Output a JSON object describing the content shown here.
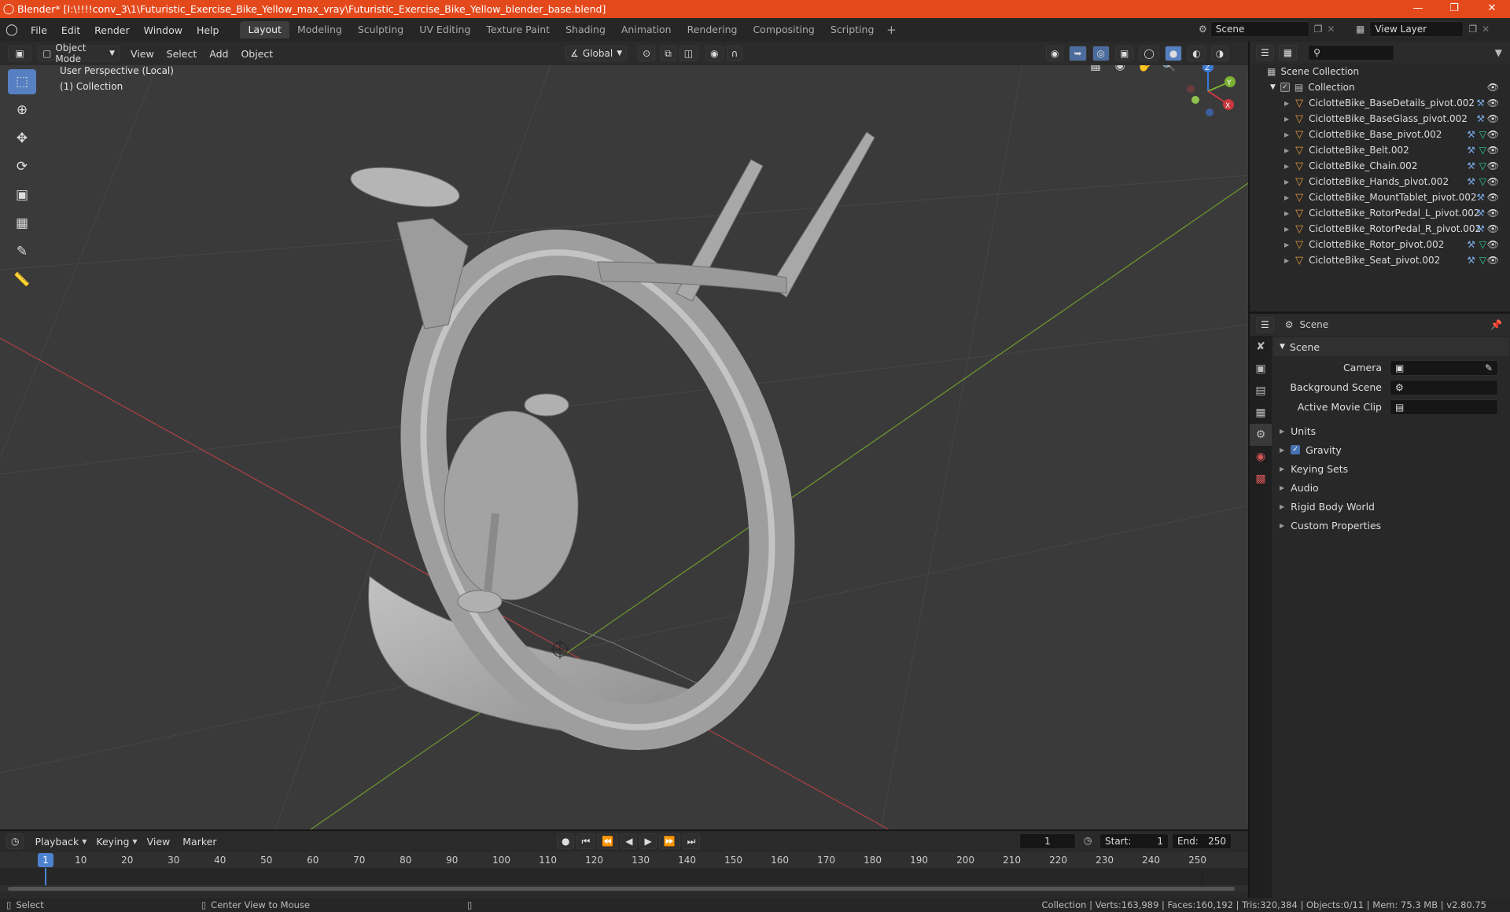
{
  "title": "Blender* [I:\\!!!!conv_3\\1\\Futuristic_Exercise_Bike_Yellow_max_vray\\Futuristic_Exercise_Bike_Yellow_blender_base.blend]",
  "menu": [
    "File",
    "Edit",
    "Render",
    "Window",
    "Help"
  ],
  "workspaces": [
    "Layout",
    "Modeling",
    "Sculpting",
    "UV Editing",
    "Texture Paint",
    "Shading",
    "Animation",
    "Rendering",
    "Compositing",
    "Scripting"
  ],
  "scene_name": "Scene",
  "view_layer": "View Layer",
  "viewport_header": {
    "mode": "Object Mode",
    "menus": [
      "View",
      "Select",
      "Add",
      "Object"
    ],
    "transform": "Global"
  },
  "viewport": {
    "perspective": "User Perspective (Local)",
    "collection": "(1) Collection"
  },
  "gizmo": {
    "x": "X",
    "y": "Y",
    "z": "Z"
  },
  "outliner": {
    "root": "Scene Collection",
    "collection": "Collection",
    "objects": [
      {
        "name": "CiclotteBike_BaseDetails_pivot.002",
        "mesh": false
      },
      {
        "name": "CiclotteBike_BaseGlass_pivot.002",
        "mesh": false
      },
      {
        "name": "CiclotteBike_Base_pivot.002",
        "mesh": true
      },
      {
        "name": "CiclotteBike_Belt.002",
        "mesh": true
      },
      {
        "name": "CiclotteBike_Chain.002",
        "mesh": true
      },
      {
        "name": "CiclotteBike_Hands_pivot.002",
        "mesh": true
      },
      {
        "name": "CiclotteBike_MountTablet_pivot.002",
        "mesh": false
      },
      {
        "name": "CiclotteBike_RotorPedal_L_pivot.002",
        "mesh": false
      },
      {
        "name": "CiclotteBike_RotorPedal_R_pivot.002",
        "mesh": false
      },
      {
        "name": "CiclotteBike_Rotor_pivot.002",
        "mesh": true
      },
      {
        "name": "CiclotteBike_Seat_pivot.002",
        "mesh": true
      }
    ]
  },
  "properties": {
    "header": "Scene",
    "panel": "Scene",
    "fields": [
      {
        "label": "Camera"
      },
      {
        "label": "Background Scene"
      },
      {
        "label": "Active Movie Clip"
      }
    ],
    "sections": [
      {
        "label": "Units",
        "checkbox": false
      },
      {
        "label": "Gravity",
        "checkbox": true
      },
      {
        "label": "Keying Sets",
        "checkbox": false
      },
      {
        "label": "Audio",
        "checkbox": false
      },
      {
        "label": "Rigid Body World",
        "checkbox": false
      },
      {
        "label": "Custom Properties",
        "checkbox": false
      }
    ]
  },
  "timeline": {
    "menus": [
      "Playback",
      "Keying",
      "View",
      "Marker"
    ],
    "current_frame": "1",
    "start_label": "Start:",
    "start": "1",
    "end_label": "End:",
    "end": "250",
    "ruler": [
      "1",
      "10",
      "20",
      "30",
      "40",
      "50",
      "60",
      "70",
      "80",
      "90",
      "100",
      "110",
      "120",
      "130",
      "140",
      "150",
      "160",
      "170",
      "180",
      "190",
      "200",
      "210",
      "220",
      "230",
      "240",
      "250"
    ]
  },
  "status": {
    "select": "Select",
    "center": "Center View to Mouse",
    "stats": "Collection | Verts:163,989 | Faces:160,192 | Tris:320,384 | Objects:0/11 | Mem: 75.3 MB | v2.80.75"
  },
  "colors": {
    "accent": "#e4491c",
    "active_tool": "#5680c2",
    "x_axis": "#c8383e",
    "y_axis": "#7ab232",
    "z_axis": "#3a7bd5",
    "mesh": "#a6a6a6"
  },
  "icons": {
    "blender": "blender-logo-icon",
    "eye": "eye-icon",
    "wrench": "wrench-icon",
    "triangle": "mesh-data-icon"
  }
}
